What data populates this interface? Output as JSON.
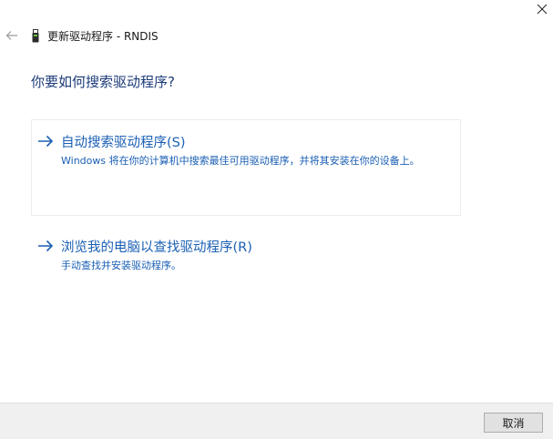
{
  "window": {
    "title": "更新驱动程序 - RNDIS"
  },
  "question": "你要如何搜索驱动程序?",
  "options": [
    {
      "label": "自动搜索驱动程序(S)",
      "description": "Windows 将在你的计算机中搜索最佳可用驱动程序，并将其安装在你的设备上。"
    },
    {
      "label": "浏览我的电脑以查找驱动程序(R)",
      "description": "手动查找并安装驱动程序。"
    }
  ],
  "footer": {
    "cancel_label": "取消"
  },
  "colors": {
    "accent": "#1a5fb4",
    "heading": "#1b3a78",
    "footer_bg": "#f0f0f0"
  },
  "icons": {
    "close": "close-icon",
    "back": "back-arrow-icon",
    "device": "usb-device-icon",
    "option_arrow": "right-arrow-icon"
  }
}
